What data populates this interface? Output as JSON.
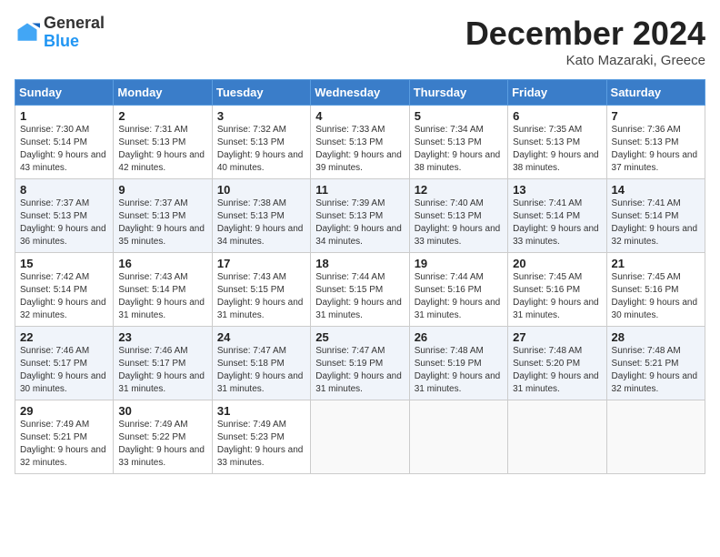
{
  "header": {
    "logo_general": "General",
    "logo_blue": "Blue",
    "month_title": "December 2024",
    "location": "Kato Mazaraki, Greece"
  },
  "days_of_week": [
    "Sunday",
    "Monday",
    "Tuesday",
    "Wednesday",
    "Thursday",
    "Friday",
    "Saturday"
  ],
  "weeks": [
    [
      {
        "day": "1",
        "sunrise": "Sunrise: 7:30 AM",
        "sunset": "Sunset: 5:14 PM",
        "daylight": "Daylight: 9 hours and 43 minutes."
      },
      {
        "day": "2",
        "sunrise": "Sunrise: 7:31 AM",
        "sunset": "Sunset: 5:13 PM",
        "daylight": "Daylight: 9 hours and 42 minutes."
      },
      {
        "day": "3",
        "sunrise": "Sunrise: 7:32 AM",
        "sunset": "Sunset: 5:13 PM",
        "daylight": "Daylight: 9 hours and 40 minutes."
      },
      {
        "day": "4",
        "sunrise": "Sunrise: 7:33 AM",
        "sunset": "Sunset: 5:13 PM",
        "daylight": "Daylight: 9 hours and 39 minutes."
      },
      {
        "day": "5",
        "sunrise": "Sunrise: 7:34 AM",
        "sunset": "Sunset: 5:13 PM",
        "daylight": "Daylight: 9 hours and 38 minutes."
      },
      {
        "day": "6",
        "sunrise": "Sunrise: 7:35 AM",
        "sunset": "Sunset: 5:13 PM",
        "daylight": "Daylight: 9 hours and 38 minutes."
      },
      {
        "day": "7",
        "sunrise": "Sunrise: 7:36 AM",
        "sunset": "Sunset: 5:13 PM",
        "daylight": "Daylight: 9 hours and 37 minutes."
      }
    ],
    [
      {
        "day": "8",
        "sunrise": "Sunrise: 7:37 AM",
        "sunset": "Sunset: 5:13 PM",
        "daylight": "Daylight: 9 hours and 36 minutes."
      },
      {
        "day": "9",
        "sunrise": "Sunrise: 7:37 AM",
        "sunset": "Sunset: 5:13 PM",
        "daylight": "Daylight: 9 hours and 35 minutes."
      },
      {
        "day": "10",
        "sunrise": "Sunrise: 7:38 AM",
        "sunset": "Sunset: 5:13 PM",
        "daylight": "Daylight: 9 hours and 34 minutes."
      },
      {
        "day": "11",
        "sunrise": "Sunrise: 7:39 AM",
        "sunset": "Sunset: 5:13 PM",
        "daylight": "Daylight: 9 hours and 34 minutes."
      },
      {
        "day": "12",
        "sunrise": "Sunrise: 7:40 AM",
        "sunset": "Sunset: 5:13 PM",
        "daylight": "Daylight: 9 hours and 33 minutes."
      },
      {
        "day": "13",
        "sunrise": "Sunrise: 7:41 AM",
        "sunset": "Sunset: 5:14 PM",
        "daylight": "Daylight: 9 hours and 33 minutes."
      },
      {
        "day": "14",
        "sunrise": "Sunrise: 7:41 AM",
        "sunset": "Sunset: 5:14 PM",
        "daylight": "Daylight: 9 hours and 32 minutes."
      }
    ],
    [
      {
        "day": "15",
        "sunrise": "Sunrise: 7:42 AM",
        "sunset": "Sunset: 5:14 PM",
        "daylight": "Daylight: 9 hours and 32 minutes."
      },
      {
        "day": "16",
        "sunrise": "Sunrise: 7:43 AM",
        "sunset": "Sunset: 5:14 PM",
        "daylight": "Daylight: 9 hours and 31 minutes."
      },
      {
        "day": "17",
        "sunrise": "Sunrise: 7:43 AM",
        "sunset": "Sunset: 5:15 PM",
        "daylight": "Daylight: 9 hours and 31 minutes."
      },
      {
        "day": "18",
        "sunrise": "Sunrise: 7:44 AM",
        "sunset": "Sunset: 5:15 PM",
        "daylight": "Daylight: 9 hours and 31 minutes."
      },
      {
        "day": "19",
        "sunrise": "Sunrise: 7:44 AM",
        "sunset": "Sunset: 5:16 PM",
        "daylight": "Daylight: 9 hours and 31 minutes."
      },
      {
        "day": "20",
        "sunrise": "Sunrise: 7:45 AM",
        "sunset": "Sunset: 5:16 PM",
        "daylight": "Daylight: 9 hours and 31 minutes."
      },
      {
        "day": "21",
        "sunrise": "Sunrise: 7:45 AM",
        "sunset": "Sunset: 5:16 PM",
        "daylight": "Daylight: 9 hours and 30 minutes."
      }
    ],
    [
      {
        "day": "22",
        "sunrise": "Sunrise: 7:46 AM",
        "sunset": "Sunset: 5:17 PM",
        "daylight": "Daylight: 9 hours and 30 minutes."
      },
      {
        "day": "23",
        "sunrise": "Sunrise: 7:46 AM",
        "sunset": "Sunset: 5:17 PM",
        "daylight": "Daylight: 9 hours and 31 minutes."
      },
      {
        "day": "24",
        "sunrise": "Sunrise: 7:47 AM",
        "sunset": "Sunset: 5:18 PM",
        "daylight": "Daylight: 9 hours and 31 minutes."
      },
      {
        "day": "25",
        "sunrise": "Sunrise: 7:47 AM",
        "sunset": "Sunset: 5:19 PM",
        "daylight": "Daylight: 9 hours and 31 minutes."
      },
      {
        "day": "26",
        "sunrise": "Sunrise: 7:48 AM",
        "sunset": "Sunset: 5:19 PM",
        "daylight": "Daylight: 9 hours and 31 minutes."
      },
      {
        "day": "27",
        "sunrise": "Sunrise: 7:48 AM",
        "sunset": "Sunset: 5:20 PM",
        "daylight": "Daylight: 9 hours and 31 minutes."
      },
      {
        "day": "28",
        "sunrise": "Sunrise: 7:48 AM",
        "sunset": "Sunset: 5:21 PM",
        "daylight": "Daylight: 9 hours and 32 minutes."
      }
    ],
    [
      {
        "day": "29",
        "sunrise": "Sunrise: 7:49 AM",
        "sunset": "Sunset: 5:21 PM",
        "daylight": "Daylight: 9 hours and 32 minutes."
      },
      {
        "day": "30",
        "sunrise": "Sunrise: 7:49 AM",
        "sunset": "Sunset: 5:22 PM",
        "daylight": "Daylight: 9 hours and 33 minutes."
      },
      {
        "day": "31",
        "sunrise": "Sunrise: 7:49 AM",
        "sunset": "Sunset: 5:23 PM",
        "daylight": "Daylight: 9 hours and 33 minutes."
      },
      null,
      null,
      null,
      null
    ]
  ]
}
